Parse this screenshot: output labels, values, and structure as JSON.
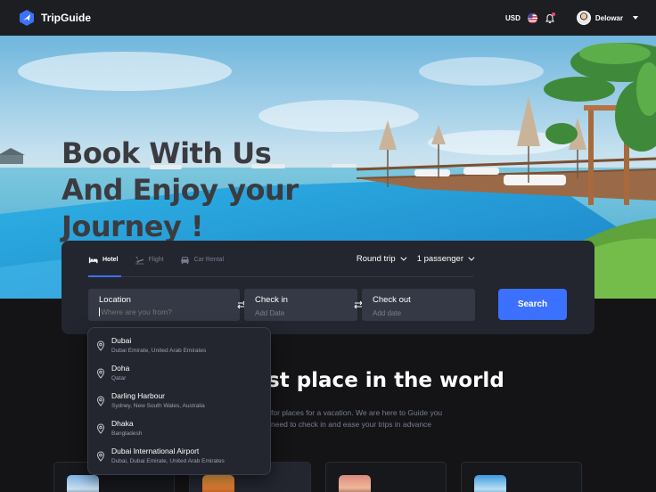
{
  "brand": {
    "name": "TripGuide"
  },
  "header": {
    "currency": "USD",
    "user_name": "Delowar"
  },
  "hero": {
    "headline_lines": [
      "Book With Us",
      "And Enjoy your",
      "Journey !"
    ]
  },
  "search": {
    "tabs": [
      {
        "label": "Hotel",
        "icon": "bed-icon",
        "active": true
      },
      {
        "label": "Flight",
        "icon": "plane-icon",
        "active": false
      },
      {
        "label": "Car Rental",
        "icon": "car-icon",
        "active": false
      }
    ],
    "trip_type": "Round trip",
    "passengers": "1 passenger",
    "location": {
      "label": "Location",
      "placeholder": "Where are you from?"
    },
    "check_in": {
      "label": "Check in",
      "value": "Add Date"
    },
    "check_out": {
      "label": "Check out",
      "value": "Add date"
    },
    "button": "Search"
  },
  "suggestions": [
    {
      "name": "Dubai",
      "detail": "Dubai Emirate, United Arab Emirates"
    },
    {
      "name": "Doha",
      "detail": "Qatar"
    },
    {
      "name": "Darling Harbour",
      "detail": "Sydney, New South Wales, Australia"
    },
    {
      "name": "Dhaka",
      "detail": "Bangladesh"
    },
    {
      "name": "Dubai International Airport",
      "detail": "Dubai, Dubai Emirate, United Arab Emirates"
    }
  ],
  "section": {
    "title_visible": "st place in the world",
    "subtitle_line1": "for places for a vacation. We are here to Guide you",
    "subtitle_line2": "need to check in and ease your trips in advance"
  },
  "colors": {
    "accent": "#3b71fe",
    "panel": "#23262f",
    "field": "#353945",
    "notification": "#ef466f"
  }
}
